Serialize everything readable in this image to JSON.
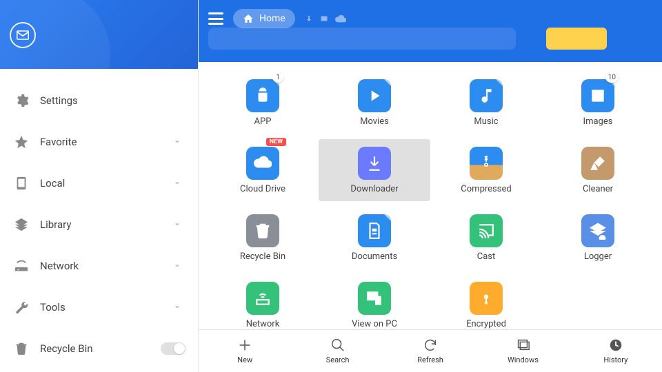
{
  "header": {
    "breadcrumb": "Home"
  },
  "sidebar": {
    "items": [
      {
        "label": "Settings"
      },
      {
        "label": "Favorite"
      },
      {
        "label": "Local"
      },
      {
        "label": "Library"
      },
      {
        "label": "Network"
      },
      {
        "label": "Tools"
      },
      {
        "label": "Recycle Bin"
      }
    ]
  },
  "grid": {
    "badge_new": "NEW",
    "tiles": [
      {
        "label": "APP",
        "badge": "1"
      },
      {
        "label": "Movies"
      },
      {
        "label": "Music"
      },
      {
        "label": "Images",
        "badge": "10"
      },
      {
        "label": "Cloud Drive",
        "new": true
      },
      {
        "label": "Downloader",
        "selected": true
      },
      {
        "label": "Compressed"
      },
      {
        "label": "Cleaner"
      },
      {
        "label": "Recycle Bin"
      },
      {
        "label": "Documents"
      },
      {
        "label": "Cast"
      },
      {
        "label": "Logger"
      },
      {
        "label": "Network"
      },
      {
        "label": "View on PC"
      },
      {
        "label": "Encrypted"
      }
    ]
  },
  "bottom": {
    "items": [
      {
        "label": "New"
      },
      {
        "label": "Search"
      },
      {
        "label": "Refresh"
      },
      {
        "label": "Windows"
      },
      {
        "label": "History"
      }
    ]
  }
}
